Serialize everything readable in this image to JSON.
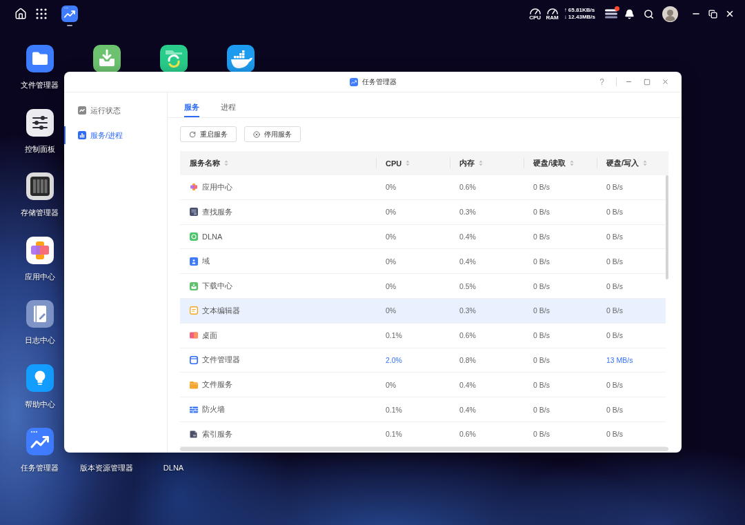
{
  "top_bar": {
    "taskbar": [
      {
        "kind": "task-manager",
        "running": true
      }
    ],
    "cpu_label": "CPU",
    "ram_label": "RAM",
    "upload": "↑ 65.81KB/s",
    "download": "↓ 12.43MB/s",
    "notification": true
  },
  "desktop": {
    "shortcuts": [
      {
        "label": "文件管理器",
        "kind": "folder"
      },
      {
        "label": "控制面板",
        "kind": "sliders"
      },
      {
        "label": "存储管理器",
        "kind": "storage"
      },
      {
        "label": "应用中心",
        "kind": "apps"
      },
      {
        "label": "日志中心",
        "kind": "log"
      },
      {
        "label": "帮助中心",
        "kind": "help"
      },
      {
        "label": "任务管理器",
        "kind": "task-manager"
      }
    ],
    "top_row": [
      {
        "kind": "download"
      },
      {
        "kind": "sync"
      },
      {
        "kind": "docker"
      }
    ],
    "bottom_row": [
      {
        "label": "版本资源管理器"
      },
      {
        "label": "DLNA"
      }
    ]
  },
  "window": {
    "title": "任务管理器",
    "help": "?",
    "sidebar": [
      {
        "label": "运行状态",
        "kind": "status",
        "selected": false
      },
      {
        "label": "服务/进程",
        "kind": "services",
        "selected": true
      }
    ],
    "tabs": [
      {
        "label": "服务",
        "selected": true
      },
      {
        "label": "进程",
        "selected": false
      }
    ],
    "buttons": [
      {
        "label": "重启服务",
        "kind": "restart"
      },
      {
        "label": "停用服务",
        "kind": "stop"
      }
    ],
    "table": {
      "columns": [
        "服务名称",
        "CPU",
        "内存",
        "硬盘/读取",
        "硬盘/写入"
      ],
      "rows": [
        {
          "kind": "apps",
          "selected": false,
          "cells": [
            {
              "text": "应用中心",
              "highlighted": false
            },
            {
              "text": "0%",
              "highlighted": false
            },
            {
              "text": "0.6%",
              "highlighted": false
            },
            {
              "text": "0 B/s",
              "highlighted": false
            },
            {
              "text": "0 B/s",
              "highlighted": false
            }
          ]
        },
        {
          "kind": "search",
          "selected": false,
          "cells": [
            {
              "text": "查找服务",
              "highlighted": false
            },
            {
              "text": "0%",
              "highlighted": false
            },
            {
              "text": "0.3%",
              "highlighted": false
            },
            {
              "text": "0 B/s",
              "highlighted": false
            },
            {
              "text": "0 B/s",
              "highlighted": false
            }
          ]
        },
        {
          "kind": "dlna",
          "selected": false,
          "cells": [
            {
              "text": "DLNA",
              "highlighted": false
            },
            {
              "text": "0%",
              "highlighted": false
            },
            {
              "text": "0.4%",
              "highlighted": false
            },
            {
              "text": "0 B/s",
              "highlighted": false
            },
            {
              "text": "0 B/s",
              "highlighted": false
            }
          ]
        },
        {
          "kind": "domain",
          "selected": false,
          "cells": [
            {
              "text": "域",
              "highlighted": false
            },
            {
              "text": "0%",
              "highlighted": false
            },
            {
              "text": "0.4%",
              "highlighted": false
            },
            {
              "text": "0 B/s",
              "highlighted": false
            },
            {
              "text": "0 B/s",
              "highlighted": false
            }
          ]
        },
        {
          "kind": "download",
          "selected": false,
          "cells": [
            {
              "text": "下载中心",
              "highlighted": false
            },
            {
              "text": "0%",
              "highlighted": false
            },
            {
              "text": "0.5%",
              "highlighted": false
            },
            {
              "text": "0 B/s",
              "highlighted": false
            },
            {
              "text": "0 B/s",
              "highlighted": false
            }
          ]
        },
        {
          "kind": "editor",
          "selected": true,
          "cells": [
            {
              "text": "文本编辑器",
              "highlighted": false
            },
            {
              "text": "0%",
              "highlighted": false
            },
            {
              "text": "0.3%",
              "highlighted": false
            },
            {
              "text": "0 B/s",
              "highlighted": false
            },
            {
              "text": "0 B/s",
              "highlighted": false
            }
          ]
        },
        {
          "kind": "desktop",
          "selected": false,
          "cells": [
            {
              "text": "桌面",
              "highlighted": false
            },
            {
              "text": "0.1%",
              "highlighted": false
            },
            {
              "text": "0.6%",
              "highlighted": false
            },
            {
              "text": "0 B/s",
              "highlighted": false
            },
            {
              "text": "0 B/s",
              "highlighted": false
            }
          ]
        },
        {
          "kind": "folder",
          "selected": false,
          "cells": [
            {
              "text": "文件管理器",
              "highlighted": false
            },
            {
              "text": "2.0%",
              "highlighted": true
            },
            {
              "text": "0.8%",
              "highlighted": false
            },
            {
              "text": "0 B/s",
              "highlighted": false
            },
            {
              "text": "13 MB/s",
              "highlighted": true
            }
          ]
        },
        {
          "kind": "file-service",
          "selected": false,
          "cells": [
            {
              "text": "文件服务",
              "highlighted": false
            },
            {
              "text": "0%",
              "highlighted": false
            },
            {
              "text": "0.4%",
              "highlighted": false
            },
            {
              "text": "0 B/s",
              "highlighted": false
            },
            {
              "text": "0 B/s",
              "highlighted": false
            }
          ]
        },
        {
          "kind": "firewall",
          "selected": false,
          "cells": [
            {
              "text": "防火墙",
              "highlighted": false
            },
            {
              "text": "0.1%",
              "highlighted": false
            },
            {
              "text": "0.4%",
              "highlighted": false
            },
            {
              "text": "0 B/s",
              "highlighted": false
            },
            {
              "text": "0 B/s",
              "highlighted": false
            }
          ]
        },
        {
          "kind": "index",
          "selected": false,
          "cells": [
            {
              "text": "索引服务",
              "highlighted": false
            },
            {
              "text": "0.1%",
              "highlighted": false
            },
            {
              "text": "0.6%",
              "highlighted": false
            },
            {
              "text": "0 B/s",
              "highlighted": false
            },
            {
              "text": "0 B/s",
              "highlighted": false
            }
          ]
        }
      ]
    }
  }
}
